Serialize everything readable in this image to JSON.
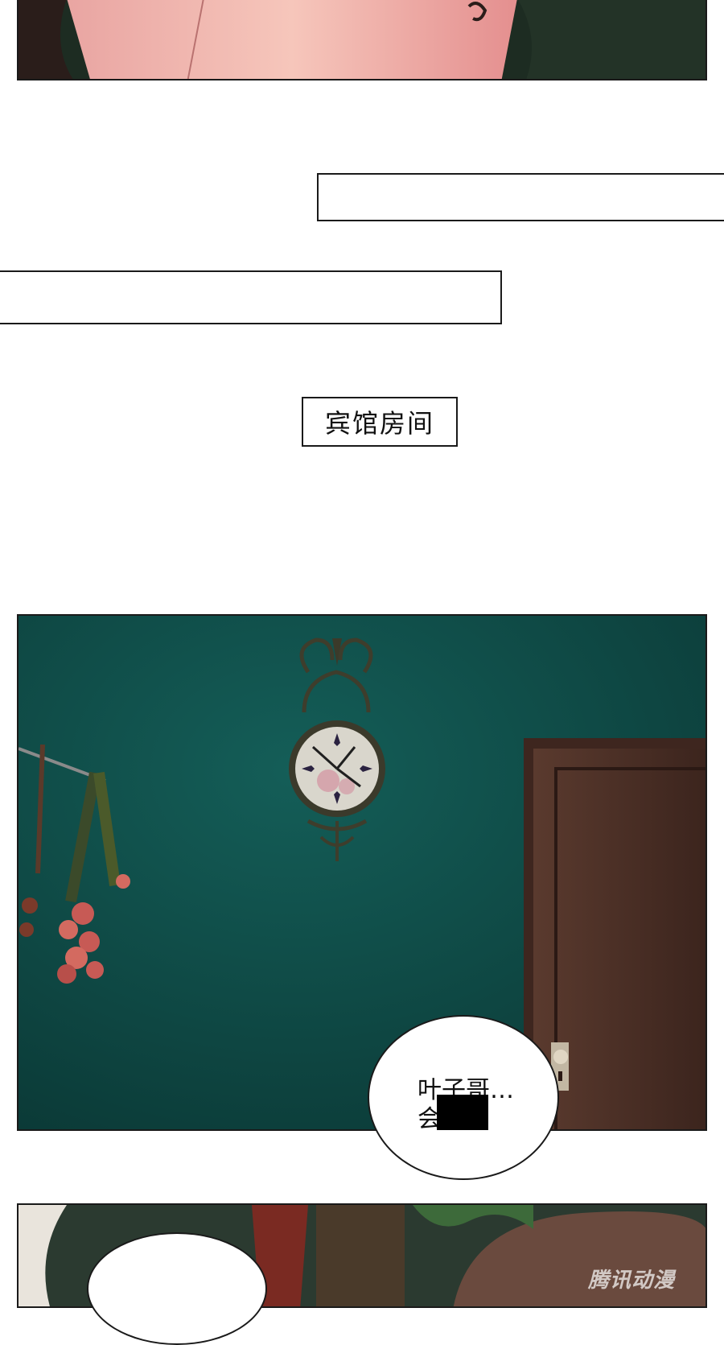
{
  "captions": {
    "location": "宾馆房间"
  },
  "speech_bubble": {
    "line1": "叶子哥…",
    "line2": "会        吗?"
  },
  "watermark": "腾讯动漫",
  "colors": {
    "wall": "#0f4a47",
    "door": "#4a2f26",
    "panel_border": "#1a1a1a"
  },
  "icons": {
    "clock": "wall-clock-icon",
    "flowers": "dried-flowers-icon",
    "door": "door-icon"
  }
}
